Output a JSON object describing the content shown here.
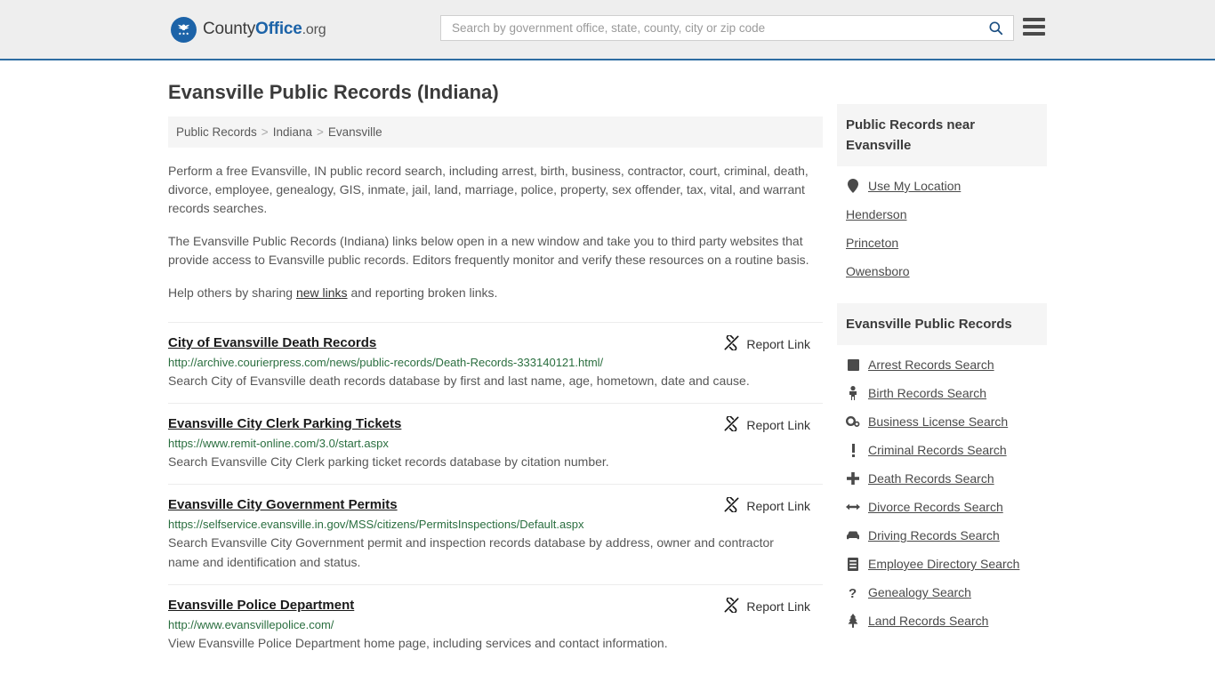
{
  "header": {
    "brand_prefix": "County",
    "brand_mid": "Office",
    "brand_suffix": ".org",
    "search_placeholder": "Search by government office, state, county, city or zip code",
    "search_value": "",
    "search_icon": "search-icon",
    "menu_icon": "hamburger-menu-icon",
    "accent_color": "#1c63a8",
    "border_color": "#2d6ca2"
  },
  "page": {
    "title": "Evansville Public Records (Indiana)"
  },
  "breadcrumb": {
    "items": [
      {
        "label": "Public Records"
      },
      {
        "label": "Indiana"
      },
      {
        "label": "Evansville"
      }
    ],
    "separator": ">"
  },
  "intro": {
    "p1": "Perform a free Evansville, IN public record search, including arrest, birth, business, contractor, court, criminal, death, divorce, employee, genealogy, GIS, inmate, jail, land, marriage, police, property, sex offender, tax, vital, and warrant records searches.",
    "p2": "The Evansville Public Records (Indiana) links below open in a new window and take you to third party websites that provide access to Evansville public records. Editors frequently monitor and verify these resources on a routine basis.",
    "p3_before": "Help others by sharing ",
    "p3_link": "new links",
    "p3_after": " and reporting broken links."
  },
  "results": {
    "report_label": "Report Link",
    "report_icon": "broken-link-icon",
    "items": [
      {
        "title": "City of Evansville Death Records",
        "url": "http://archive.courierpress.com/news/public-records/Death-Records-333140121.html/",
        "description": "Search City of Evansville death records database by first and last name, age, hometown, date and cause."
      },
      {
        "title": "Evansville City Clerk Parking Tickets",
        "url": "https://www.remit-online.com/3.0/start.aspx",
        "description": "Search Evansville City Clerk parking ticket records database by citation number."
      },
      {
        "title": "Evansville City Government Permits",
        "url": "https://selfservice.evansville.in.gov/MSS/citizens/PermitsInspections/Default.aspx",
        "description": "Search Evansville City Government permit and inspection records database by address, owner and contractor name and identification and status."
      },
      {
        "title": "Evansville Police Department",
        "url": "http://www.evansvillepolice.com/",
        "description": "View Evansville Police Department home page, including services and contact information."
      }
    ]
  },
  "sidebar": {
    "nearby": {
      "heading": "Public Records near Evansville",
      "items": [
        {
          "label": "Use My Location",
          "icon": "map-pin-icon"
        },
        {
          "label": "Henderson",
          "icon": ""
        },
        {
          "label": "Princeton",
          "icon": ""
        },
        {
          "label": "Owensboro",
          "icon": ""
        }
      ]
    },
    "records": {
      "heading": "Evansville Public Records",
      "items": [
        {
          "label": "Arrest Records Search",
          "icon": "square-icon"
        },
        {
          "label": "Birth Records Search",
          "icon": "child-icon"
        },
        {
          "label": "Business License Search",
          "icon": "gears-icon"
        },
        {
          "label": "Criminal Records Search",
          "icon": "exclamation-icon"
        },
        {
          "label": "Death Records Search",
          "icon": "plus-icon"
        },
        {
          "label": "Divorce Records Search",
          "icon": "arrows-horizontal-icon"
        },
        {
          "label": "Driving Records Search",
          "icon": "car-icon"
        },
        {
          "label": "Employee Directory Search",
          "icon": "list-alt-icon"
        },
        {
          "label": "Genealogy Search",
          "icon": "question-mark-icon"
        },
        {
          "label": "Land Records Search",
          "icon": "tree-icon"
        }
      ]
    }
  }
}
